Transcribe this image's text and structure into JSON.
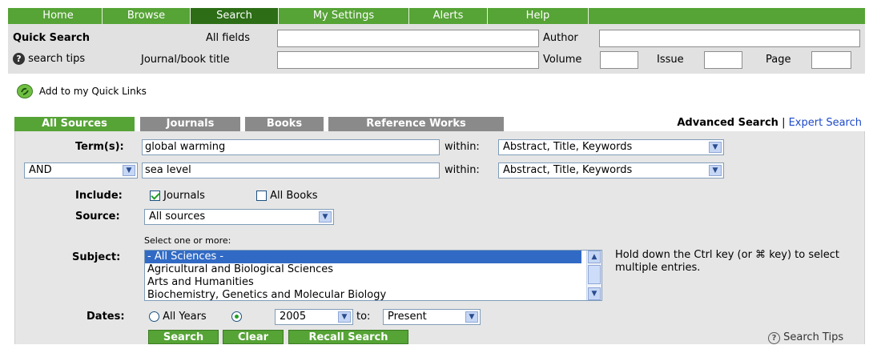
{
  "nav": {
    "tabs": [
      {
        "label": "Home",
        "active": false
      },
      {
        "label": "Browse",
        "active": false
      },
      {
        "label": "Search",
        "active": true
      },
      {
        "label": "My Settings",
        "active": false
      },
      {
        "label": "Alerts",
        "active": false
      },
      {
        "label": "Help",
        "active": false
      }
    ]
  },
  "quick_search": {
    "title": "Quick Search",
    "all_fields_label": "All fields",
    "all_fields_value": "",
    "author_label": "Author",
    "author_value": "",
    "search_tips_label": "search tips",
    "journal_label": "Journal/book title",
    "journal_value": "",
    "volume_label": "Volume",
    "volume_value": "",
    "issue_label": "Issue",
    "issue_value": "",
    "page_label": "Page",
    "page_value": ""
  },
  "quick_links": {
    "label": "Add to my Quick Links"
  },
  "source_tabs": [
    {
      "label": "All Sources",
      "active": true
    },
    {
      "label": "Journals",
      "active": false
    },
    {
      "label": "Books",
      "active": false
    },
    {
      "label": "Reference Works",
      "active": false
    }
  ],
  "search_modes": {
    "advanced": "Advanced Search",
    "separator": "|",
    "expert": "Expert Search"
  },
  "form": {
    "terms_label": "Term(s):",
    "term1": "global warming",
    "within_label": "within:",
    "within1": "Abstract, Title, Keywords",
    "operator": "AND",
    "term2": "sea level",
    "within2": "Abstract, Title, Keywords",
    "include_label": "Include:",
    "include_journals": "Journals",
    "include_books": "All Books",
    "source_label": "Source:",
    "source_value": "All sources",
    "subject_hint": "Select one or more:",
    "subject_label": "Subject:",
    "subjects": [
      "- All Sciences -",
      "Agricultural and Biological Sciences",
      "Arts and Humanities",
      "Biochemistry, Genetics and Molecular Biology"
    ],
    "subject_help": "Hold down the Ctrl key (or ⌘ key) to select multiple entries.",
    "dates_label": "Dates:",
    "all_years": "All Years",
    "year_from": "2005",
    "to_label": "to:",
    "year_to": "Present"
  },
  "buttons": {
    "search": "Search",
    "clear": "Clear",
    "recall": "Recall Search"
  },
  "search_tips_bottom": "Search Tips",
  "colors": {
    "brand_green": "#56a336",
    "active_green": "#2c6d16",
    "tab_gray": "#8a8a8a",
    "link_blue": "#1d49c9",
    "selection_blue": "#316ac5"
  }
}
